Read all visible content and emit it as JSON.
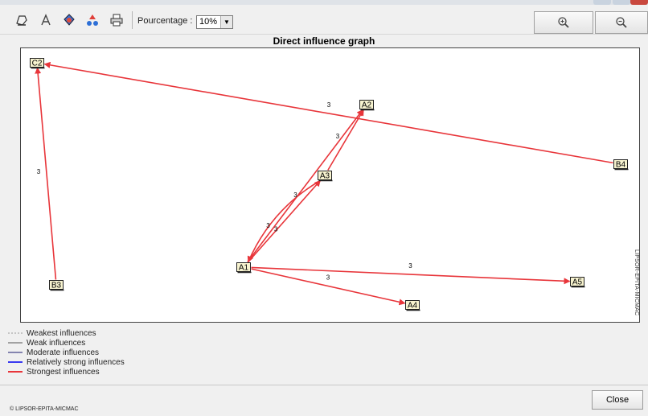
{
  "toolbar": {
    "icons": [
      "copy-icon",
      "font-icon",
      "color-icon",
      "filter-icon",
      "print-icon"
    ],
    "percentage_label": "Pourcentage :",
    "percentage_value": "10%",
    "zoom_in_icon": "zoom-in-icon",
    "zoom_out_icon": "zoom-out-icon"
  },
  "graph": {
    "title": "Direct influence graph",
    "nodes": [
      {
        "id": "C2",
        "label": "C2"
      },
      {
        "id": "A2",
        "label": "A2"
      },
      {
        "id": "B4",
        "label": "B4"
      },
      {
        "id": "A3",
        "label": "A3"
      },
      {
        "id": "A1",
        "label": "A1"
      },
      {
        "id": "B3",
        "label": "B3"
      },
      {
        "id": "A5",
        "label": "A5"
      },
      {
        "id": "A4",
        "label": "A4"
      }
    ],
    "edges": [
      {
        "from": "B4",
        "to": "C2",
        "weight": "3",
        "strength": "Strongest influences"
      },
      {
        "from": "B3",
        "to": "C2",
        "weight": "3",
        "strength": "Strongest influences"
      },
      {
        "from": "A3",
        "to": "A2",
        "weight": "3",
        "strength": "Strongest influences"
      },
      {
        "from": "A1",
        "to": "A2",
        "weight": "3",
        "strength": "Strongest influences"
      },
      {
        "from": "A1",
        "to": "A3",
        "weight": "3",
        "strength": "Strongest influences"
      },
      {
        "from": "A3",
        "to": "A1",
        "weight": "3",
        "strength": "Strongest influences"
      },
      {
        "from": "A1",
        "to": "A5",
        "weight": "3",
        "strength": "Strongest influences"
      },
      {
        "from": "A1",
        "to": "A4",
        "weight": "3",
        "strength": "Strongest influences"
      }
    ],
    "watermark": "LIPSOR-EPITA-MICMAC"
  },
  "legend": [
    {
      "label": "Weakest influences",
      "color": "#9a9a9a"
    },
    {
      "label": "Weak influences",
      "color": "#555555"
    },
    {
      "label": "Moderate influences",
      "color": "#1a1a6e"
    },
    {
      "label": "Relatively strong influences",
      "color": "#3a3af0"
    },
    {
      "label": "Strongest influences",
      "color": "#e8353a"
    }
  ],
  "footer": {
    "copyright": "© LIPSOR-EPITA-MICMAC",
    "close_label": "Close"
  }
}
